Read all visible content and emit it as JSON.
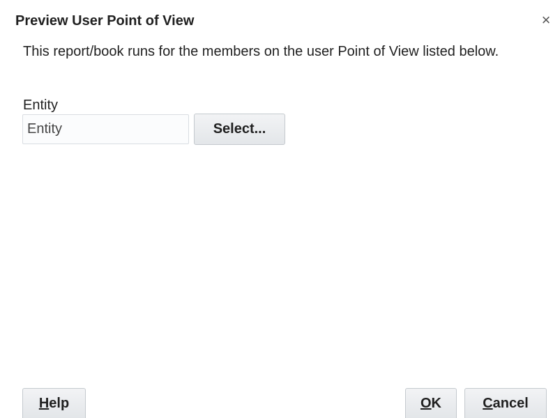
{
  "dialog": {
    "title": "Preview User Point of View",
    "close_glyph": "×",
    "close_icon": "close-icon",
    "description": "This report/book runs for the members on the user Point of View listed below."
  },
  "entity": {
    "label": "Entity",
    "input_placeholder": "Entity",
    "select_label": "Select..."
  },
  "footer": {
    "help": {
      "mnemonic": "H",
      "rest": "elp"
    },
    "ok": {
      "mnemonic": "O",
      "rest": "K"
    },
    "cancel": {
      "mnemonic": "C",
      "rest": "ancel"
    }
  }
}
